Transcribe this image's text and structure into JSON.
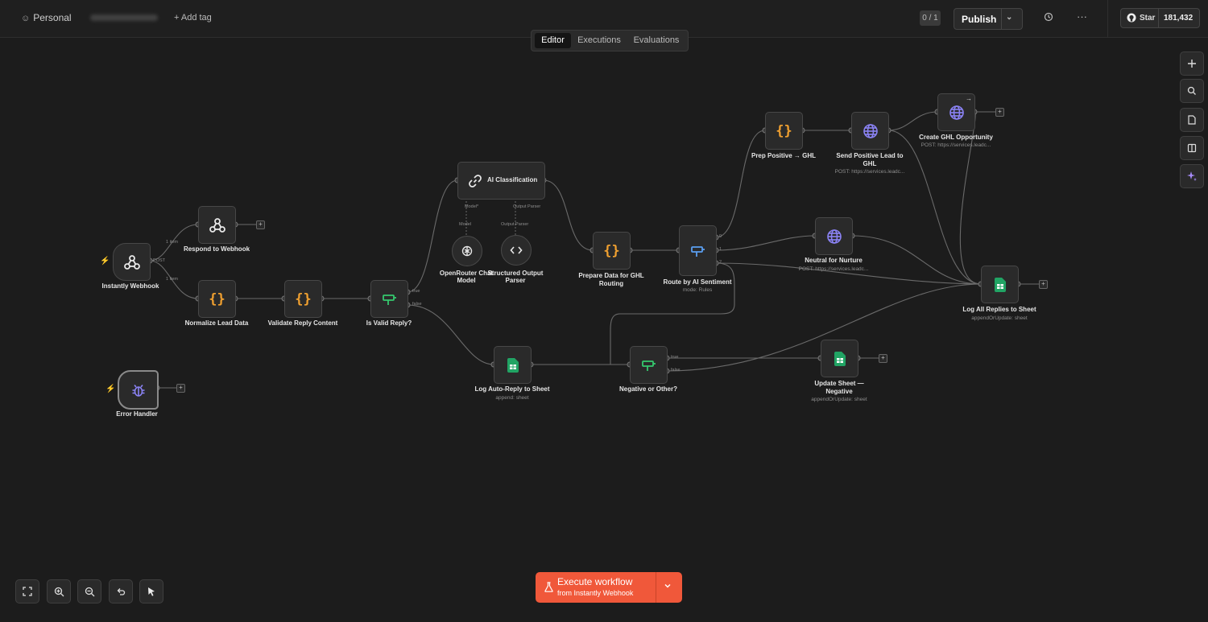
{
  "topbar": {
    "workspace": "Personal",
    "add_tag": "+ Add tag",
    "version_count": "0 / 1",
    "publish_label": "Publish",
    "github_star_label": "Star",
    "github_star_count": "181,432"
  },
  "tabs": [
    "Editor",
    "Executions",
    "Evaluations"
  ],
  "active_tab": "Editor",
  "nodes": {
    "instantly_webhook": {
      "label": "Instantly Webhook",
      "icon": "webhook-icon"
    },
    "respond_to_webhook": {
      "label": "Respond to Webhook",
      "icon": "webhook-icon"
    },
    "normalize_lead_data": {
      "label": "Normalize Lead Data",
      "icon": "code-braces-icon"
    },
    "validate_reply_content": {
      "label": "Validate Reply Content",
      "icon": "code-braces-icon"
    },
    "is_valid_reply": {
      "label": "Is Valid Reply?",
      "icon": "if-branch-icon"
    },
    "ai_classification": {
      "label": "AI Classification",
      "icon": "chain-link-icon"
    },
    "openrouter_chat_model": {
      "label1": "OpenRouter Chat",
      "label2": "Model",
      "icon": "openrouter-icon"
    },
    "structured_output_parser": {
      "label1": "Structured Output",
      "label2": "Parser",
      "icon": "code-brackets-icon"
    },
    "prepare_data_ghl": {
      "label1": "Prepare Data for GHL",
      "label2": "Routing",
      "icon": "code-braces-icon"
    },
    "route_by_ai_sentiment": {
      "label": "Route by AI Sentiment",
      "sub": "mode: Rules",
      "icon": "switch-icon"
    },
    "prep_positive_ghl": {
      "label": "Prep Positive → GHL",
      "icon": "code-braces-icon"
    },
    "send_positive_lead": {
      "label1": "Send Positive Lead to",
      "label2": "GHL",
      "sub": "POST: https://services.leadc...",
      "icon": "globe-icon"
    },
    "create_ghl_opportunity": {
      "label": "Create GHL Opportunity",
      "sub": "POST: https://services.leadc...",
      "icon": "globe-icon"
    },
    "neutral_for_nurture": {
      "label": "Neutral for Nurture",
      "sub": "POST: https://services.leadc...",
      "icon": "globe-icon"
    },
    "log_all_replies": {
      "label": "Log All Replies to Sheet",
      "sub": "appendOrUpdate: sheet",
      "icon": "google-sheets-icon"
    },
    "log_auto_reply": {
      "label": "Log Auto-Reply to Sheet",
      "sub": "append: sheet",
      "icon": "google-sheets-icon"
    },
    "negative_or_other": {
      "label": "Negative or Other?",
      "icon": "if-branch-icon"
    },
    "update_sheet_negative": {
      "label1": "Update Sheet —",
      "label2": "Negative",
      "sub": "appendOrUpdate: sheet",
      "icon": "google-sheets-icon"
    },
    "error_handler": {
      "label": "Error Handler",
      "icon": "bug-icon"
    }
  },
  "edge_labels": {
    "one_item_a": "1 item",
    "one_item_b": "1 item",
    "post": "POST",
    "true_a": "true",
    "false_a": "false",
    "true_b": "true",
    "false_b": "false",
    "model": "Model*",
    "model2": "Model",
    "output_parser": "Output Parser",
    "output_parser2": "Output Parser",
    "out0": "0",
    "out1": "1",
    "out2": "2"
  },
  "execute": {
    "label": "Execute workflow",
    "sub": "from Instantly Webhook"
  },
  "colors": {
    "canvas_bg": "#1c1c1c",
    "node_bg": "#2a2a2a",
    "code_orange": "#f0a030",
    "if_green": "#35c96e",
    "globe_purple": "#8b83f5",
    "sheets_green": "#21a464",
    "execute_red": "#f0583a"
  }
}
